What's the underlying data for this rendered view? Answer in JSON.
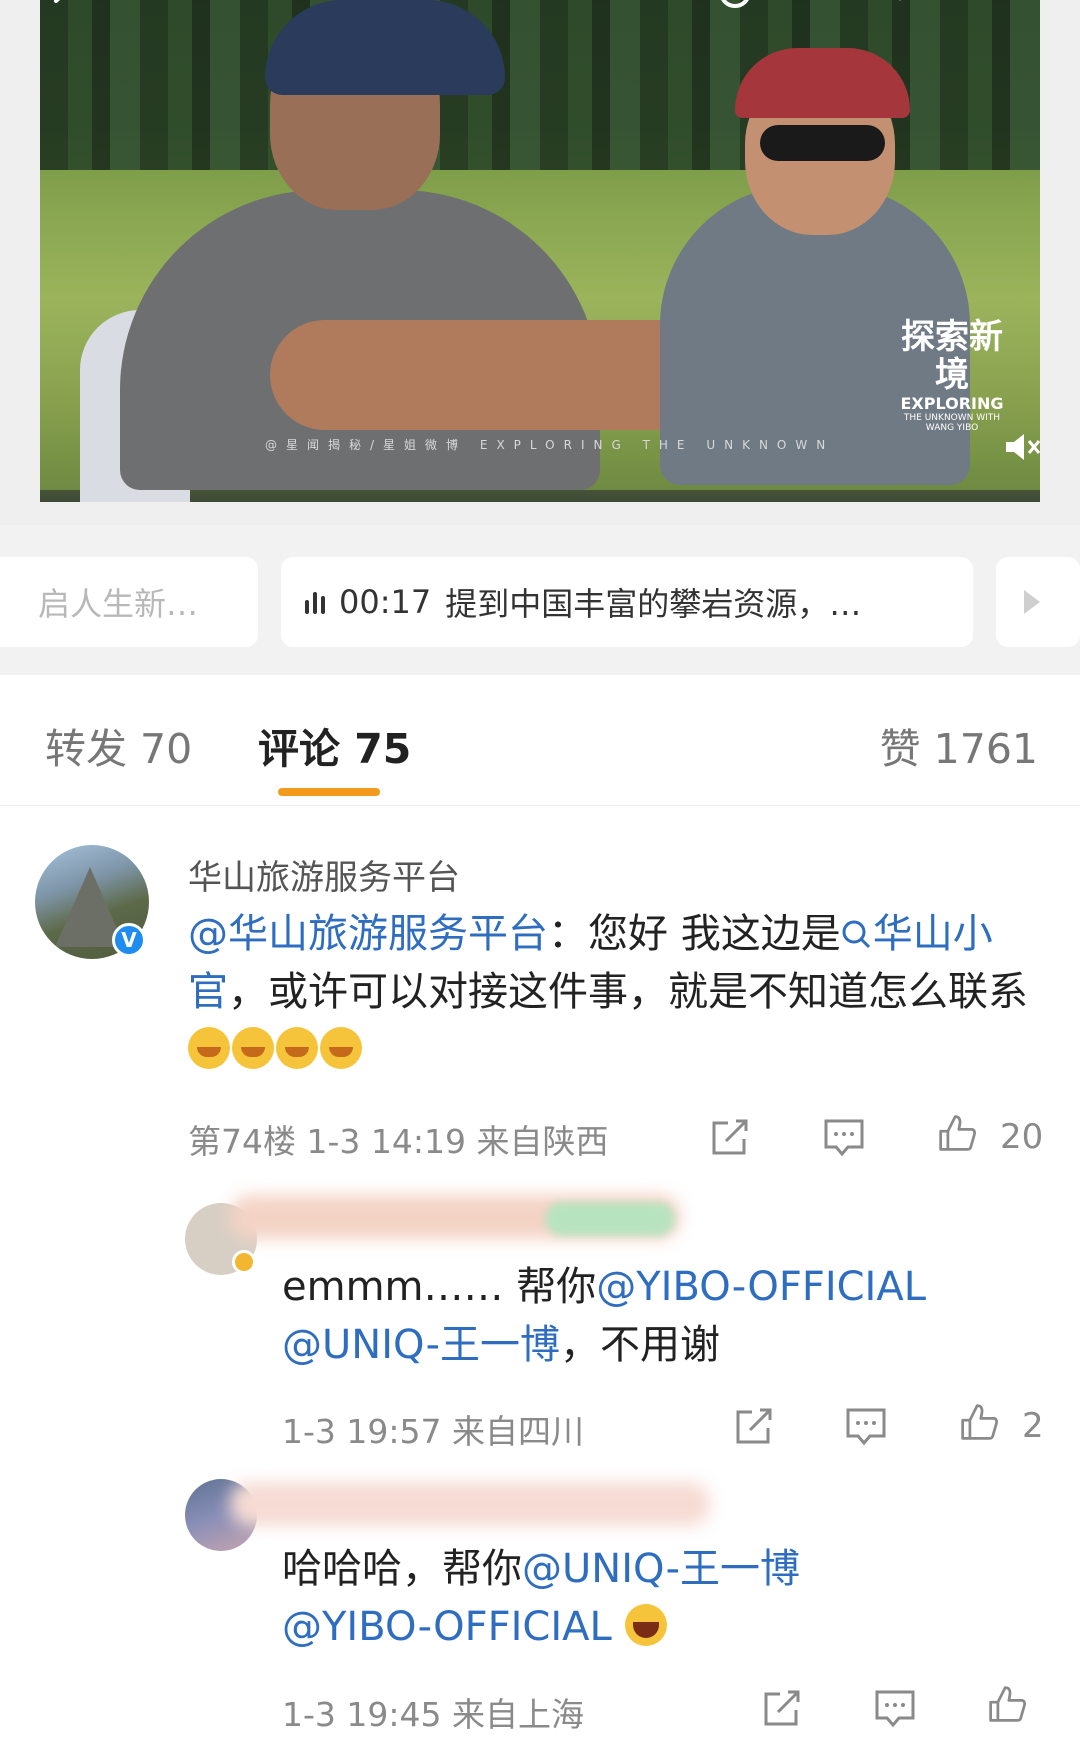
{
  "video": {
    "watermark": "@星闻揭秘/星姐微博    EXPLORING THE UNKNOWN",
    "logo_zh": "探索新境",
    "logo_en": "EXPLORING",
    "logo_sub": "THE UNKNOWN WITH WANG YIBO"
  },
  "captions": {
    "left_chip": "启人生新…",
    "main_chip_time": "00:17",
    "main_chip_text": "提到中国丰富的攀岩资源，…"
  },
  "tabs": {
    "repost": "转发 70",
    "comment": "评论 75",
    "like": "赞 1761"
  },
  "comments": [
    {
      "username": "华山旅游服务平台",
      "mention": "@华山旅游服务平台",
      "text_part1": "：您好 我这边是",
      "search_link": "华山小官",
      "text_part2": "，或许可以对接这件事，就是不知道怎么联系",
      "meta": "第74楼  1-3 14:19  来自陕西",
      "likes": "20"
    },
    {
      "prefix": "emmm……  帮你",
      "mention1": "@YIBO-OFFICIAL",
      "mention2": "@UNIQ-王一博",
      "suffix": "，不用谢",
      "meta": "1-3 19:57  来自四川",
      "likes": "2"
    },
    {
      "prefix": "哈哈哈，帮你",
      "mention1": "@UNIQ-王一博",
      "mention2": "@YIBO-OFFICIAL",
      "meta": "1-3 19:45  来自上海"
    }
  ],
  "colors": {
    "link": "#2f6dc1",
    "accent_underline": "#f29a1c",
    "verified": "#1f8cf0"
  }
}
